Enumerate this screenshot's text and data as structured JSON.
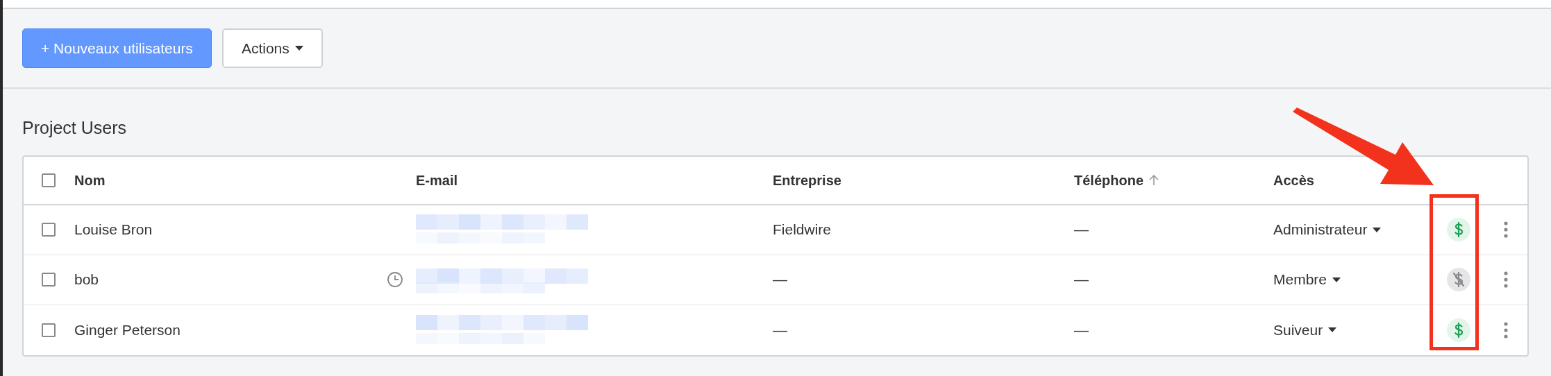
{
  "toolbar": {
    "new_button": "+ Nouveaux utilisateurs",
    "actions_button": "Actions"
  },
  "section_title": "Project Users",
  "table": {
    "select_all_checked": false,
    "columns": [
      {
        "label": "Nom",
        "sorted": false
      },
      {
        "label": "E-mail",
        "sorted": false
      },
      {
        "label": "Entreprise",
        "sorted": false
      },
      {
        "label": "Téléphone",
        "sorted": true
      },
      {
        "label": "Accès",
        "sorted": false
      }
    ],
    "rows": [
      {
        "checked": false,
        "name": "Louise Bron",
        "pending": false,
        "company": "Fieldwire",
        "phone": "—",
        "access": "Administrateur",
        "billable": true
      },
      {
        "checked": false,
        "name": "bob",
        "pending": true,
        "company": "—",
        "phone": "—",
        "access": "Membre",
        "billable": false
      },
      {
        "checked": false,
        "name": "Ginger Peterson",
        "pending": false,
        "company": "—",
        "phone": "—",
        "access": "Suiveur",
        "billable": true
      }
    ]
  }
}
